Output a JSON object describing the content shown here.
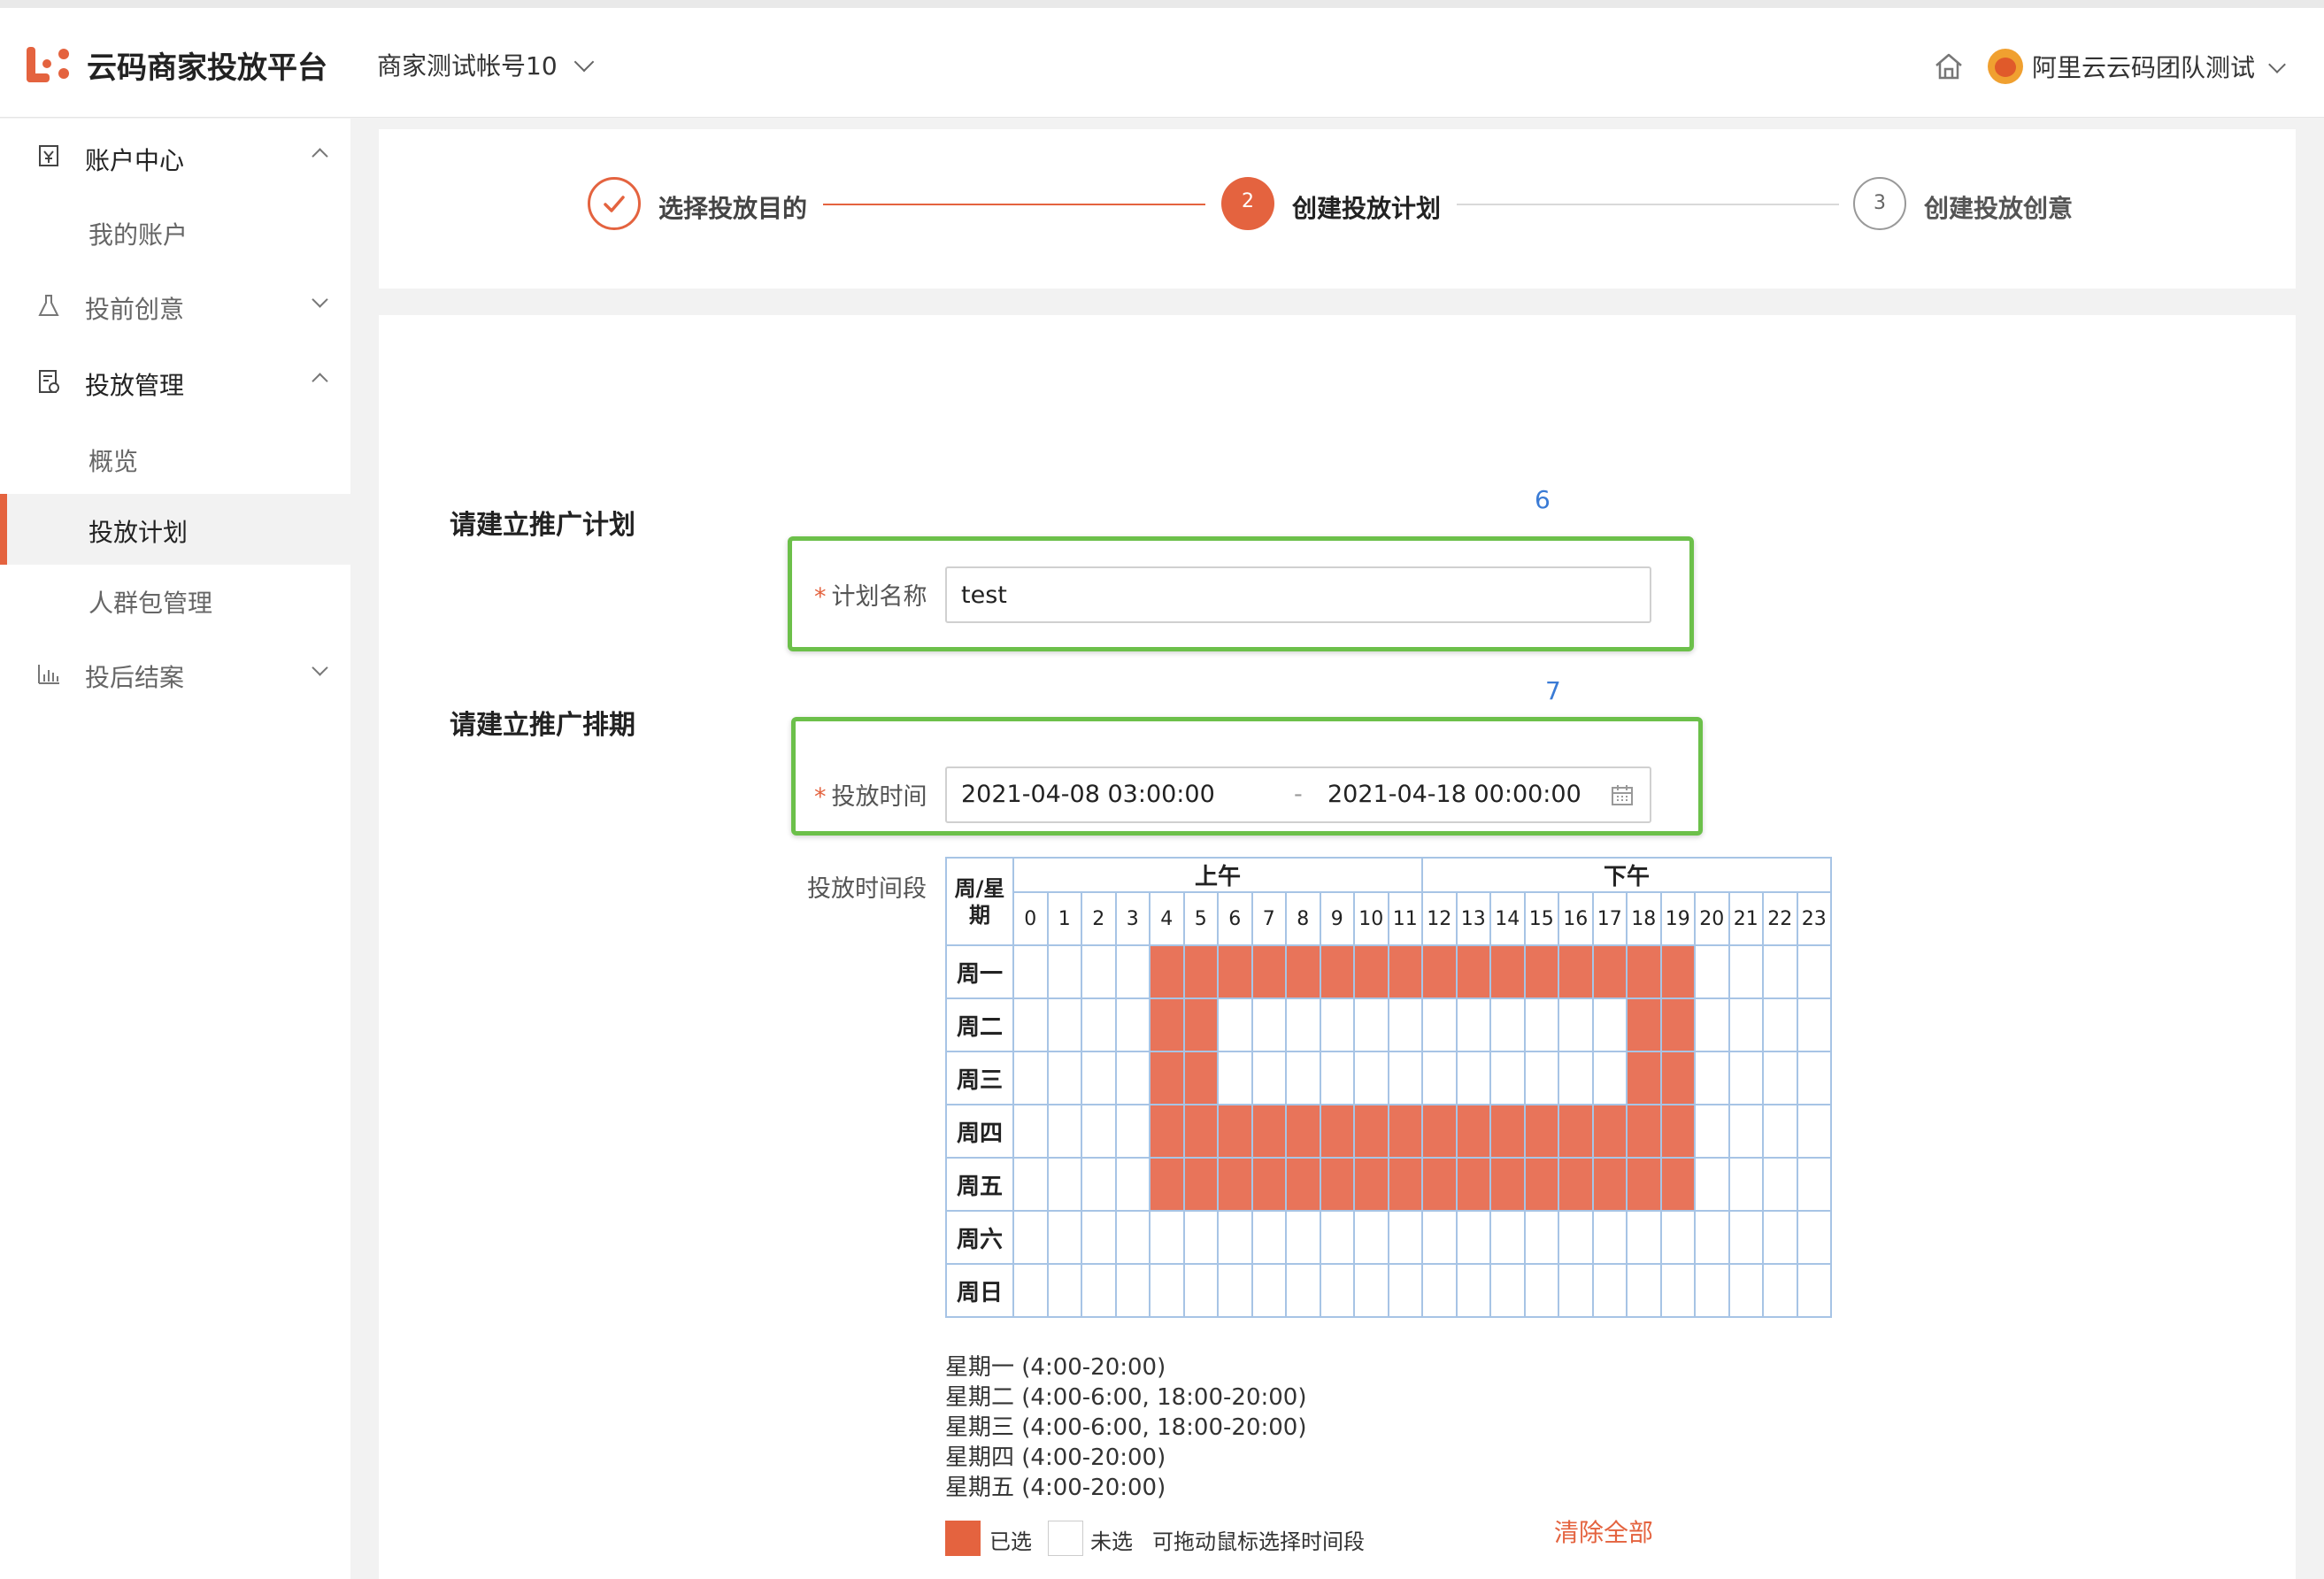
{
  "header": {
    "brand": "云码商家投放平台",
    "account": "商家测试帐号10",
    "user": "阿里云云码团队测试"
  },
  "sidebar": {
    "items": [
      {
        "label": "账户中心",
        "type": "group",
        "expanded": true,
        "icon": "account-icon"
      },
      {
        "label": "我的账户",
        "type": "sub"
      },
      {
        "label": "投前创意",
        "type": "group",
        "expanded": false,
        "icon": "flask-icon"
      },
      {
        "label": "投放管理",
        "type": "group",
        "expanded": true,
        "icon": "doc-icon"
      },
      {
        "label": "概览",
        "type": "sub"
      },
      {
        "label": "投放计划",
        "type": "sub",
        "active": true
      },
      {
        "label": "人群包管理",
        "type": "sub"
      },
      {
        "label": "投后结案",
        "type": "group",
        "expanded": false,
        "icon": "bar-chart-icon"
      }
    ]
  },
  "steps": [
    {
      "num": "1",
      "label": "选择投放目的",
      "state": "done"
    },
    {
      "num": "2",
      "label": "创建投放计划",
      "state": "current"
    },
    {
      "num": "3",
      "label": "创建投放创意",
      "state": "todo"
    }
  ],
  "form": {
    "section1_title": "请建立推广计划",
    "annotation1": "6",
    "plan_name_label": "计划名称",
    "plan_name_value": "test",
    "section2_title": "请建立推广排期",
    "annotation2": "7",
    "time_label": "投放时间",
    "start_time": "2021-04-08 03:00:00",
    "separator": "-",
    "end_time": "2021-04-18 00:00:00",
    "period_label": "投放时间段"
  },
  "schedule": {
    "am_label": "上午",
    "pm_label": "下午",
    "corner_label": "周/星期",
    "hours": [
      "0",
      "1",
      "2",
      "3",
      "4",
      "5",
      "6",
      "7",
      "8",
      "9",
      "10",
      "11",
      "12",
      "13",
      "14",
      "15",
      "16",
      "17",
      "18",
      "19",
      "20",
      "21",
      "22",
      "23"
    ],
    "days": [
      "周一",
      "周二",
      "周三",
      "周四",
      "周五",
      "周六",
      "周日"
    ],
    "selected": [
      [
        4,
        5,
        6,
        7,
        8,
        9,
        10,
        11,
        12,
        13,
        14,
        15,
        16,
        17,
        18,
        19
      ],
      [
        4,
        5,
        18,
        19
      ],
      [
        4,
        5,
        18,
        19
      ],
      [
        4,
        5,
        6,
        7,
        8,
        9,
        10,
        11,
        12,
        13,
        14,
        15,
        16,
        17,
        18,
        19
      ],
      [
        4,
        5,
        6,
        7,
        8,
        9,
        10,
        11,
        12,
        13,
        14,
        15,
        16,
        17,
        18,
        19
      ],
      [],
      []
    ],
    "selected_color": "#e8745a",
    "summary": [
      "星期一 (4:00-20:00)",
      "星期二 (4:00-6:00, 18:00-20:00)",
      "星期三 (4:00-6:00, 18:00-20:00)",
      "星期四 (4:00-20:00)",
      "星期五 (4:00-20:00)"
    ]
  },
  "legend": {
    "selected": "已选",
    "unselected": "未选",
    "hint": "可拖动鼠标选择时间段",
    "clear_all": "清除全部"
  },
  "colors": {
    "accent": "#e4633f",
    "highlight_box": "#6cc04a",
    "annotation": "#3a7bd5"
  }
}
